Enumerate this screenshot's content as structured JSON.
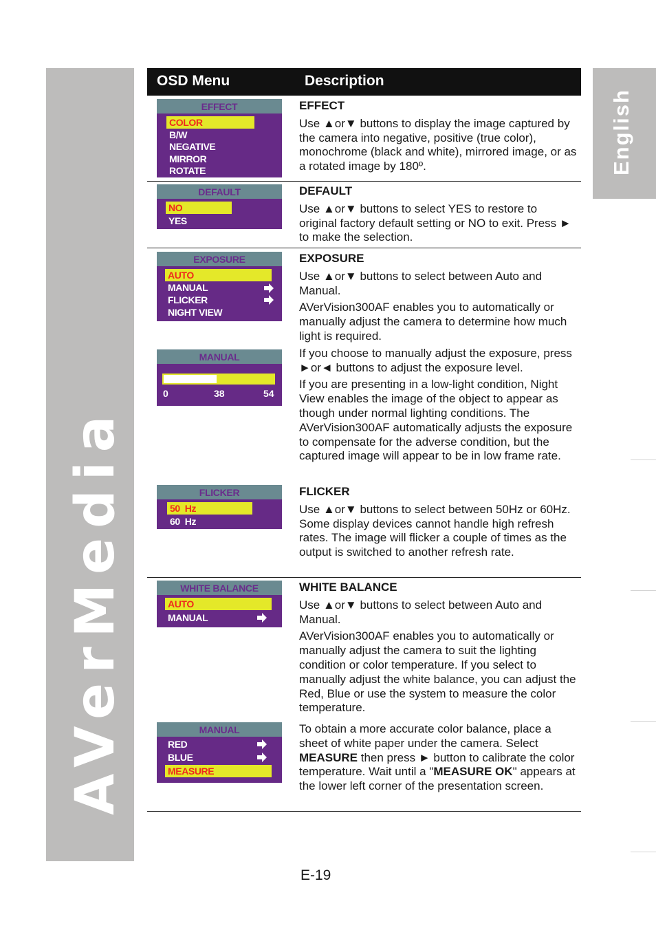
{
  "sidebar": {
    "brand": "AVerMedia",
    "language_tab": "English"
  },
  "table": {
    "col_osd": "OSD Menu",
    "col_desc": "Description"
  },
  "osd_menus": {
    "effect": {
      "title": "EFFECT",
      "items": [
        "COLOR",
        "B/W",
        "NEGATIVE",
        "MIRROR",
        "ROTATE"
      ],
      "selected": "COLOR"
    },
    "default": {
      "title": "DEFAULT",
      "items": [
        "NO",
        "YES"
      ],
      "selected": "NO"
    },
    "exposure": {
      "title": "EXPOSURE",
      "items": [
        "AUTO",
        "MANUAL",
        "FLICKER",
        "NIGHT VIEW"
      ],
      "selected": "AUTO",
      "submenu_items": [
        "MANUAL",
        "FLICKER"
      ]
    },
    "exposure_manual": {
      "title": "MANUAL",
      "min": "0",
      "current": "38",
      "max": "54",
      "value": 38,
      "range": [
        0,
        54
      ]
    },
    "flicker": {
      "title": "FLICKER",
      "items": [
        "50  Hz",
        "60  Hz"
      ],
      "selected": "50  Hz"
    },
    "white_balance": {
      "title": "WHITE  BALANCE",
      "items": [
        "AUTO",
        "MANUAL"
      ],
      "selected": "AUTO",
      "submenu_items": [
        "MANUAL"
      ]
    },
    "wb_manual": {
      "title": "MANUAL",
      "items": [
        "RED",
        "BLUE",
        "MEASURE"
      ],
      "selected": "MEASURE",
      "submenu_items": [
        "RED",
        "BLUE"
      ]
    }
  },
  "descriptions": {
    "effect": {
      "title": "EFFECT",
      "p1": "Use ▲or▼ buttons to display the image captured by the camera into negative, positive (true color), monochrome (black and white), mirrored image, or as a rotated image by 180º."
    },
    "default": {
      "title": "DEFAULT",
      "p1": "Use ▲or▼ buttons to select YES to restore to original factory default setting or NO to exit. Press ► to make the selection."
    },
    "exposure": {
      "title": "EXPOSURE",
      "p1": "Use ▲or▼ buttons to select between Auto and Manual.",
      "p2": "AVerVision300AF enables you to automatically or manually adjust the camera to determine how much light is required.",
      "p3": "If you choose to manually adjust the exposure, press ►or◄ buttons to adjust the exposure level.",
      "p4": "If you are presenting in a low-light condition, Night View enables the image of the object to appear as though under normal lighting conditions. The AVerVision300AF automatically adjusts the exposure to compensate for the adverse condition, but the captured image will appear to be in low frame rate."
    },
    "flicker": {
      "title": "FLICKER",
      "p1": "Use ▲or▼ buttons to select between 50Hz or 60Hz. Some display devices cannot handle high refresh rates. The image will flicker a couple of times as the output is switched to another refresh rate."
    },
    "white_balance": {
      "title": "WHITE BALANCE",
      "p1": "Use ▲or▼ buttons to select between Auto and Manual.",
      "p2": "AVerVision300AF enables you to automatically or manually adjust the camera to suit the lighting condition or color temperature.    If you select to manually adjust the white balance, you can adjust the Red, Blue or use the system to measure the color temperature.",
      "p3_a": "To obtain a more accurate color balance, place a sheet of white paper under the camera. Select ",
      "p3_b": "MEASURE",
      "p3_c": " then press ► button to calibrate the color temperature. Wait until a \"",
      "p3_d": "MEASURE OK",
      "p3_e": "\" appears at the lower left corner of the presentation screen."
    }
  },
  "footer": {
    "page_number": "E-19"
  },
  "colors": {
    "osd_bg": "#662a86",
    "osd_title_bg": "#6a8a91",
    "osd_title_text": "#6a2c8c",
    "highlight_bg": "#e4e829",
    "highlight_text": "#ef2a1c",
    "band_gray": "#bdbcbb"
  }
}
